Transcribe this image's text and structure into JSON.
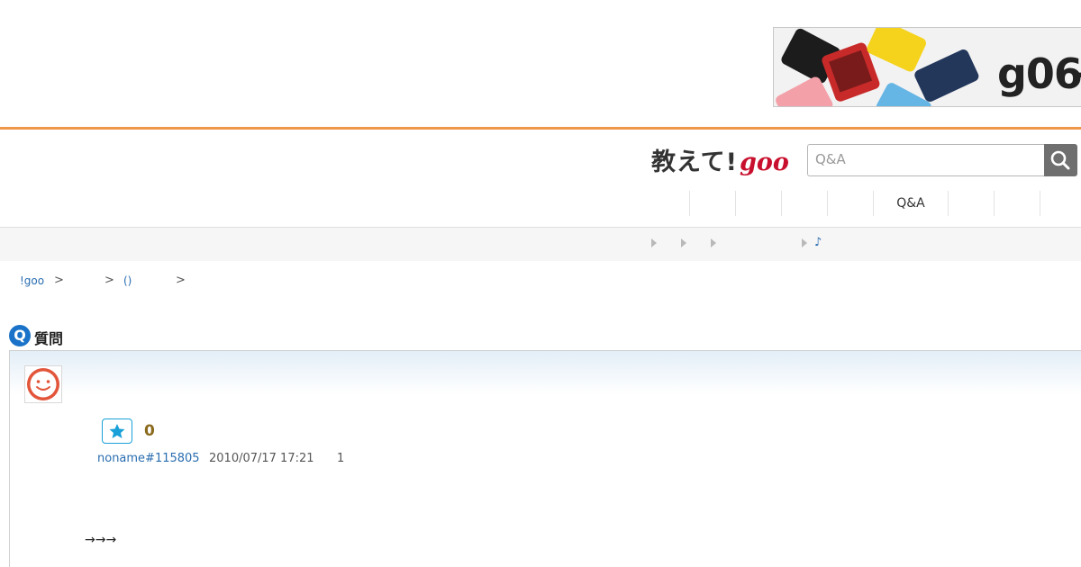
{
  "ad": {
    "brand": "g06",
    "brand_suffix": "+"
  },
  "header": {
    "logo_jp": "教えて!",
    "logo_goo": "goo",
    "search_placeholder": "Q&A"
  },
  "nav": {
    "items": [
      "",
      "",
      "",
      "",
      "Q&A",
      "",
      "",
      ""
    ]
  },
  "subbar": {
    "note": "♪"
  },
  "breadcrumb": {
    "home": "!goo",
    "sep": ">",
    "category": "()"
  },
  "question": {
    "badge": "Q",
    "section_title": "質問",
    "likes": "0",
    "user": "noname#115805",
    "date": "2010/07/17 17:21",
    "answers": "1",
    "body": "→→→"
  },
  "colors": {
    "accent_orange": "#f0964b",
    "link_blue": "#2a6db0",
    "goo_red": "#c8102e",
    "star_blue": "#1aa0d8"
  }
}
